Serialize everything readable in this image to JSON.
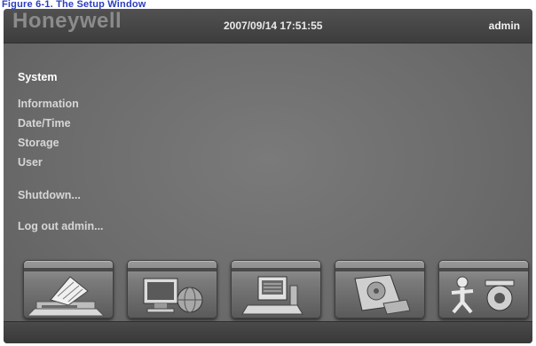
{
  "caption": "Figure 6-1. The Setup Window",
  "header": {
    "logo": "Honeywell",
    "datetime": "2007/09/14  17:51:55",
    "user": "admin"
  },
  "menu": {
    "items": [
      {
        "label": "System"
      },
      {
        "label": "Information"
      },
      {
        "label": "Date/Time"
      },
      {
        "label": "Storage"
      },
      {
        "label": "User"
      },
      {
        "label": "Shutdown..."
      },
      {
        "label": "Log out admin..."
      }
    ]
  },
  "dock": {
    "icons": [
      "system-setup-icon",
      "network-setup-icon",
      "recording-setup-icon",
      "storage-setup-icon",
      "camera-setup-icon"
    ]
  }
}
